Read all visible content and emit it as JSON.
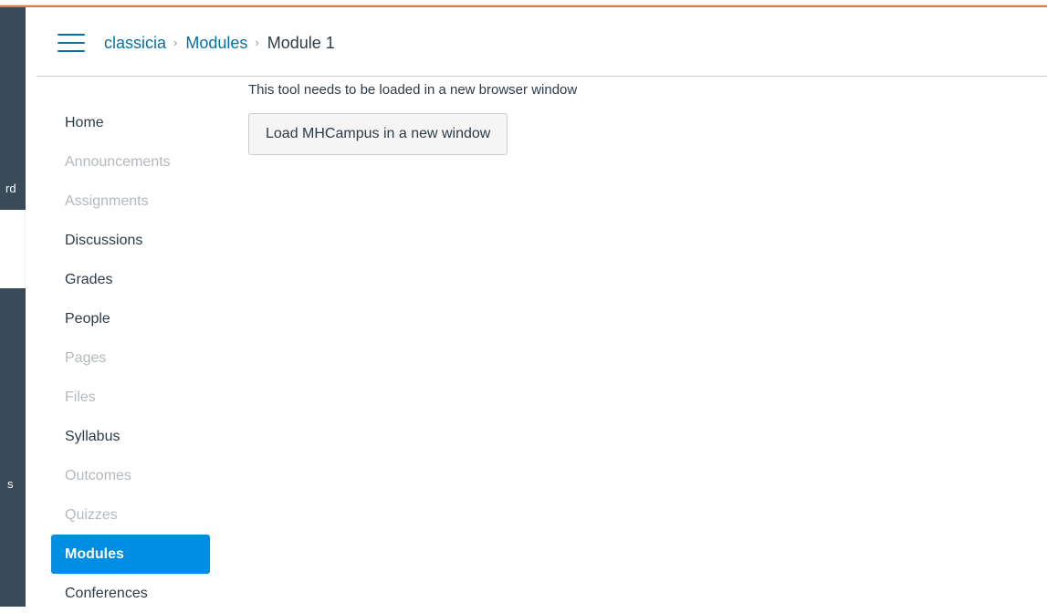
{
  "colors": {
    "link": "#0770a3",
    "active_nav_bg": "#008ee2",
    "disabled_text": "#b3b9bd",
    "global_nav_bg": "#394b58",
    "accent_orange": "#e8793a"
  },
  "global_nav": {
    "fragments": [
      "rd",
      "s"
    ]
  },
  "header": {
    "menu_icon": "hamburger-menu-icon",
    "breadcrumb": {
      "course": "classicia",
      "section": "Modules",
      "current": "Module 1",
      "separator": "›"
    }
  },
  "course_nav": {
    "items": [
      {
        "label": "Home",
        "state": "enabled"
      },
      {
        "label": "Announcements",
        "state": "disabled"
      },
      {
        "label": "Assignments",
        "state": "disabled"
      },
      {
        "label": "Discussions",
        "state": "enabled"
      },
      {
        "label": "Grades",
        "state": "enabled"
      },
      {
        "label": "People",
        "state": "enabled"
      },
      {
        "label": "Pages",
        "state": "disabled"
      },
      {
        "label": "Files",
        "state": "disabled"
      },
      {
        "label": "Syllabus",
        "state": "enabled"
      },
      {
        "label": "Outcomes",
        "state": "disabled"
      },
      {
        "label": "Quizzes",
        "state": "disabled"
      },
      {
        "label": "Modules",
        "state": "active"
      },
      {
        "label": "Conferences",
        "state": "enabled"
      }
    ]
  },
  "content": {
    "message": "This tool needs to be loaded in a new browser window",
    "button_label": "Load MHCampus in a new window"
  }
}
